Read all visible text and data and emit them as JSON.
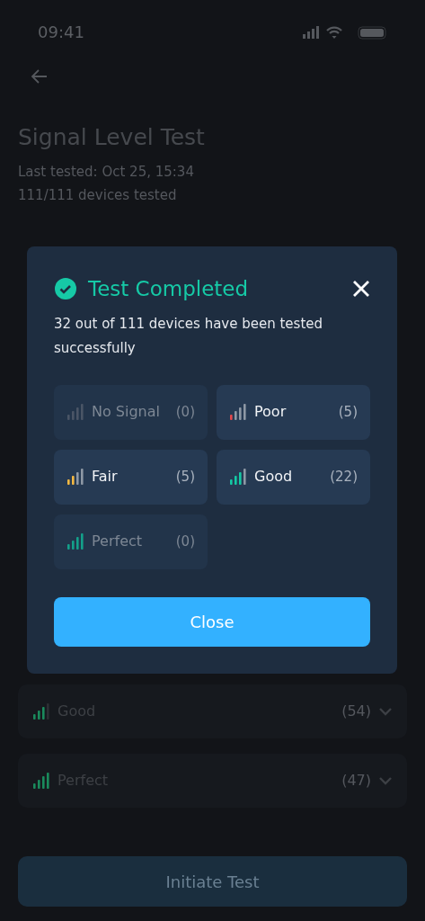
{
  "status_bar": {
    "time": "09:41"
  },
  "header": {
    "title": "Signal Level Test",
    "last_tested": "Last tested: Oct 25, 15:34",
    "devices_tested": "111/111 devices tested"
  },
  "groups": [
    {
      "label": "Good",
      "count": "(54)",
      "kind": "good",
      "color": "#1a8a5c"
    },
    {
      "label": "Perfect",
      "count": "(47)",
      "kind": "perfect",
      "color": "#1a8a5c"
    }
  ],
  "primary_button": {
    "label": "Initiate Test",
    "disabled": true
  },
  "dialog": {
    "title": "Test Completed",
    "message": "32 out of 111 devices have been tested successfully",
    "categories": [
      {
        "label": "No Signal",
        "count": "(0)",
        "kind": "none",
        "disabled": true
      },
      {
        "label": "Poor",
        "count": "(5)",
        "kind": "poor",
        "color": "#e5484d",
        "disabled": false
      },
      {
        "label": "Fair",
        "count": "(5)",
        "kind": "fair",
        "color": "#f5b942",
        "disabled": false
      },
      {
        "label": "Good",
        "count": "(22)",
        "kind": "good",
        "color": "#14c9a4",
        "disabled": false
      },
      {
        "label": "Perfect",
        "count": "(0)",
        "kind": "perfect",
        "color": "#14a08a",
        "disabled": true
      }
    ],
    "button": "Close"
  }
}
